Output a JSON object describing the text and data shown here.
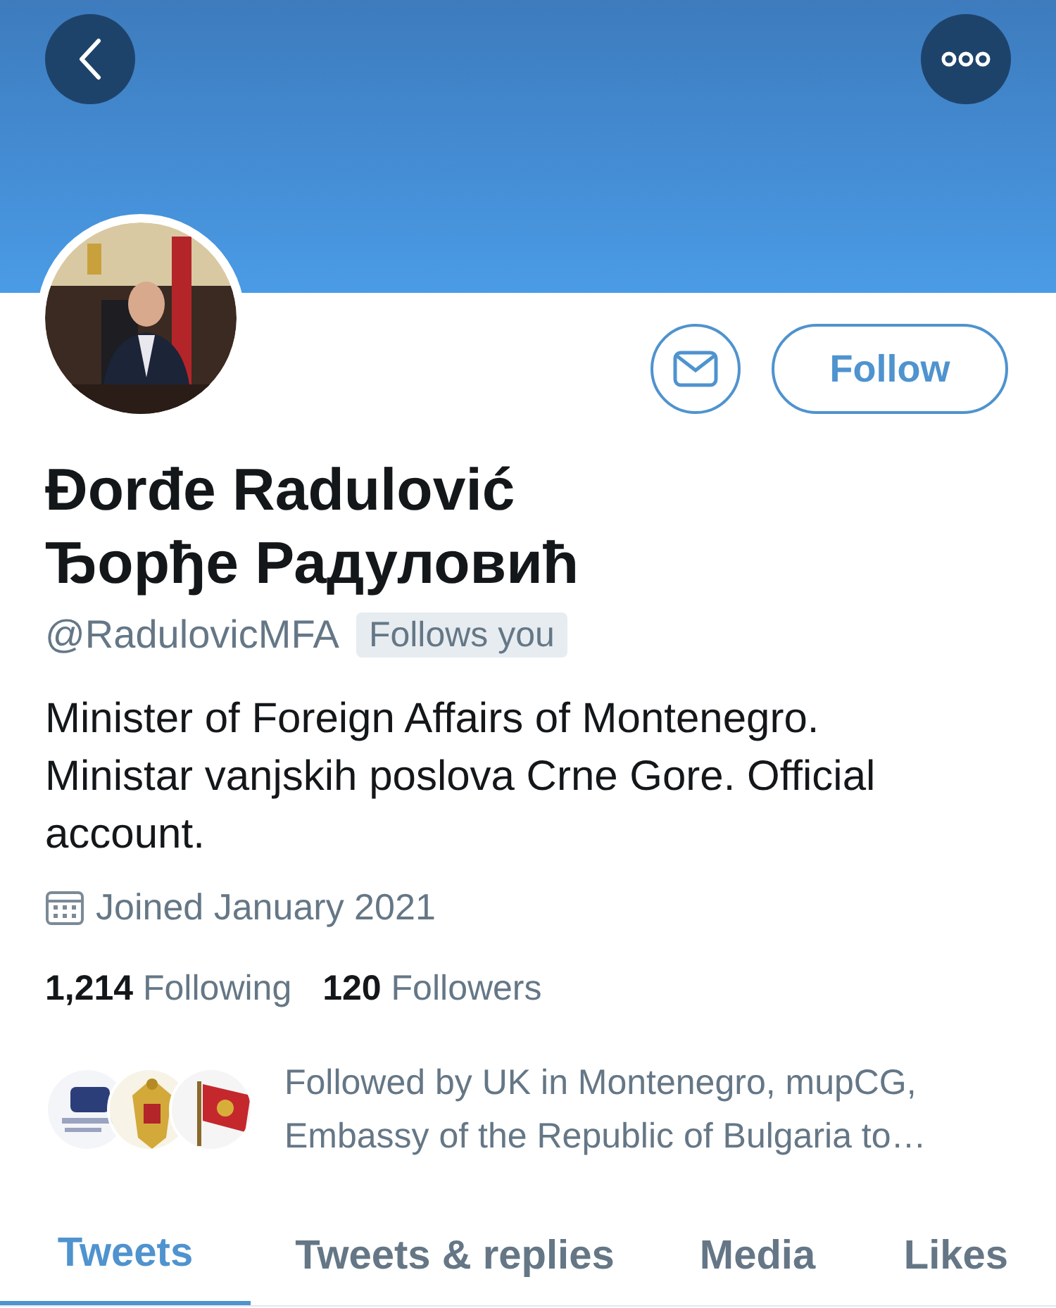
{
  "profile": {
    "name_latin": "Đorđe Radulović",
    "name_cyrillic": "Ђорђе Радуловић",
    "handle": "@RadulovicMFA",
    "follows_you": "Follows you",
    "bio": "Minister of Foreign Affairs of Montenegro. Ministar vanjskih poslova Crne Gore. Official account.",
    "joined": "Joined January 2021",
    "stats": [
      {
        "count": "1,214",
        "label": "Following"
      },
      {
        "count": "120",
        "label": "Followers"
      }
    ],
    "followed_by": "Followed by UK in Montenegro, mupCG, Embassy of the Republic of Bulgaria to…"
  },
  "actions": {
    "follow": "Follow"
  },
  "tabs": [
    {
      "label": "Tweets",
      "selected": true
    },
    {
      "label": "Tweets & replies",
      "selected": false
    },
    {
      "label": "Media",
      "selected": false
    },
    {
      "label": "Likes",
      "selected": false
    }
  ]
}
